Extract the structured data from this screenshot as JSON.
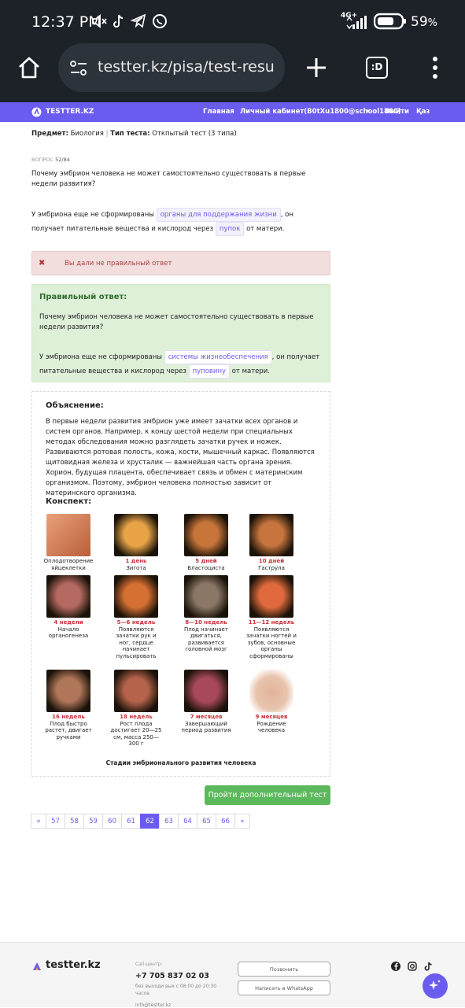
{
  "status_bar": {
    "time": "12:37 PM",
    "battery": "59",
    "battery_unit": "%",
    "network": "4G+"
  },
  "browser": {
    "url": "testter.kz/pisa/test-result/s",
    "tabs_label": ":D"
  },
  "site_nav": {
    "brand": "TESTTER.KZ",
    "links": [
      "Главная",
      "Личный кабинет(B0tXu1800@school1800)",
      "Выйти",
      "Қаз"
    ]
  },
  "meta": {
    "subject_label": "Предмет:",
    "subject": "Биология",
    "type_label": "Тип теста:",
    "type": "Откпытый тест (3 типа)"
  },
  "question": {
    "number_label": "ВОПРОС",
    "number": "52/84",
    "text": "Почему эмбрион человека не может самостоятельно существовать в первые недели развития?",
    "answer_part1": "У эмбриона еще не сформированы",
    "answer_blank1": "органы для поддержания жизни",
    "answer_part2": ", он получает питательные вещества и кислород через",
    "answer_blank2": "пупок",
    "answer_part3": "от матери."
  },
  "error_message": "Вы дали не правильный ответ",
  "correct": {
    "title": "Правильный ответ:",
    "question": "Почему эмбрион человека не может самостоятельно существовать в первые недели развития?",
    "part1": "У эмбриона еще не сформированы",
    "blank1": "системы жизнеобеспечения",
    "part2": ", он получает питательные вещества и кислород через",
    "blank2": "пуповину",
    "part3": "от матери."
  },
  "explanation": {
    "title": "Объяснение:",
    "text": "В первые недели развития эмбрион  уже  имеет зачатки всех органов и систем органов. Например, к концу шестой недели при специальных методах обследования можно разглядеть зачатки ручек и ножек. Развиваются ротовая полость, кожа, кости, мышечный каркас. Появляются щитовидная железа и хрусталик — важнейшая часть органа зрения. Хорион, будущая плацента, обеспечивает связь и обмен с материнским организмом. Поэтому, эмбрион человека полностью зависит от материнского организма.",
    "summary_title": "Конспект:",
    "stages": [
      {
        "title": "",
        "desc": "Оплодотворение яйцеклетки",
        "color": "#d9925a"
      },
      {
        "title": "1 день",
        "desc": "Зигота",
        "color": "#e8a447"
      },
      {
        "title": "5 дней",
        "desc": "Бластоциста",
        "color": "#c8753a"
      },
      {
        "title": "10 дней",
        "desc": "Гаструла",
        "color": "#c7743e"
      },
      {
        "title": "4 недели",
        "desc": "Начало органогенеза",
        "color": "#b56a61"
      },
      {
        "title": "5—6 недель",
        "desc": "Появляются зачатки рук и ног, сердце начинает пульсировать",
        "color": "#d67032"
      },
      {
        "title": "8—10 недель",
        "desc": "Плод начинает двигаться, развивается головной мозг",
        "color": "#8a7766"
      },
      {
        "title": "11—12 недель",
        "desc": "Появляются зачатки ногтей и зубов, основные органы сформированы",
        "color": "#e06a3d"
      },
      {
        "title": "16 недель",
        "desc": "Плод быстро растет, двигает ручками",
        "color": "#b07659"
      },
      {
        "title": "18 недель",
        "desc": "Рост плода достигает 20—25 см, масса 250—300 г",
        "color": "#b5634b"
      },
      {
        "title": "7 месяцев",
        "desc": "Завершающий период развития",
        "color": "#a8495a"
      },
      {
        "title": "9 месяцев",
        "desc": "Рождение человека",
        "color": "#e3b39a"
      }
    ],
    "caption": "Стадии эмбрионального развития человека"
  },
  "extra_test_button": "Пройти дополнительный тест",
  "pagination": {
    "prev": "«",
    "pages": [
      "57",
      "58",
      "59",
      "60",
      "61",
      "62",
      "63",
      "64",
      "65",
      "66"
    ],
    "current": "62",
    "next": "»"
  },
  "footer": {
    "brand": "testter.kz",
    "callcenter_label": "Call-центр:",
    "phone": "+7 705 837 02 03",
    "hours": "без выходи вых с 08:00 до 20:30 часов",
    "email": "info@testter.kz",
    "call_button": "Позвонить",
    "whatsapp_button": "Написать в WhatsApp"
  }
}
